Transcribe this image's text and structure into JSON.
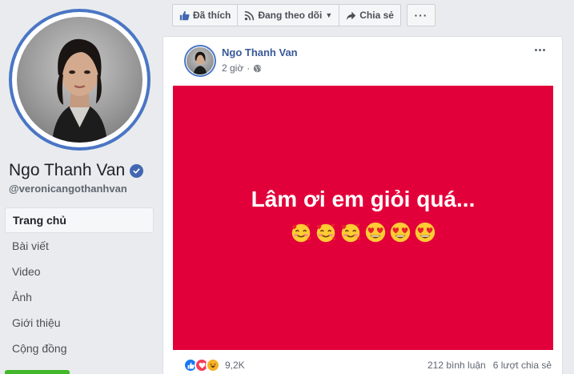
{
  "profile": {
    "name": "Ngo Thanh Van",
    "username": "@veronicangothanhvan",
    "verified": true
  },
  "nav": {
    "items": [
      {
        "label": "Trang chủ",
        "active": true
      },
      {
        "label": "Bài viết",
        "active": false
      },
      {
        "label": "Video",
        "active": false
      },
      {
        "label": "Ảnh",
        "active": false
      },
      {
        "label": "Giới thiệu",
        "active": false
      },
      {
        "label": "Cộng đồng",
        "active": false
      }
    ]
  },
  "actions": {
    "liked_label": "Đã thích",
    "following_label": "Đang theo dõi",
    "share_label": "Chia sẻ",
    "more_icon": "more-icon"
  },
  "post": {
    "author": "Ngo Thanh Van",
    "time": "2 giờ",
    "privacy_icon": "globe-icon",
    "text": "Lâm ơi em giỏi quá...",
    "background_color": "#e2003a",
    "emojis": [
      "smiling-face-with-hearts",
      "smiling-face-with-hearts",
      "smiling-face-with-hearts",
      "heart-eyes",
      "heart-eyes",
      "heart-eyes"
    ],
    "reactions": {
      "icons": [
        "like",
        "love",
        "haha"
      ],
      "count": "9,2K"
    },
    "comments": "212 bình luận",
    "shares": "6 lượt chia sẻ"
  },
  "colors": {
    "accent": "#4267b2",
    "link": "#385898",
    "page_bg": "#e9ebee"
  }
}
